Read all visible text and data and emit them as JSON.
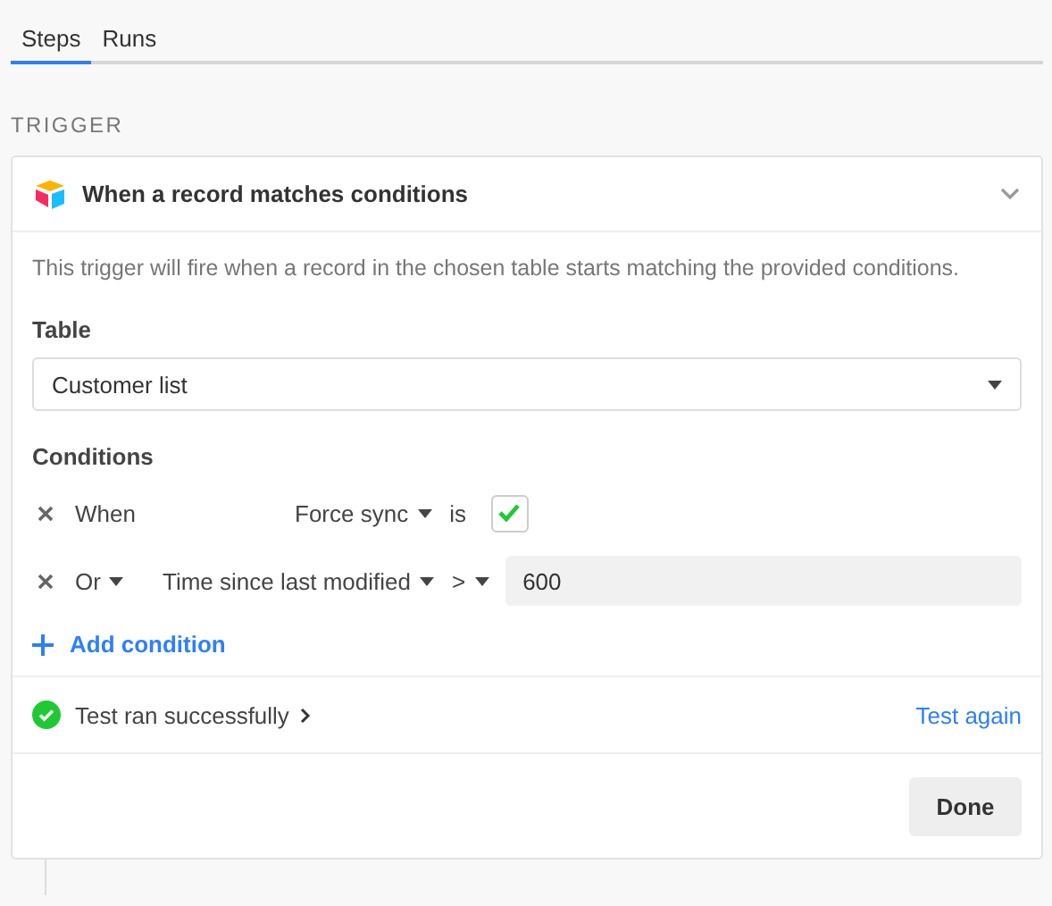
{
  "tabs": [
    {
      "label": "Steps",
      "selected": true
    },
    {
      "label": "Runs",
      "selected": false
    }
  ],
  "section_title": "TRIGGER",
  "trigger": {
    "title": "When a record matches conditions",
    "expanded": true,
    "description": "This trigger will fire when a record in the chosen table starts matching the provided conditions.",
    "table": {
      "label": "Table",
      "value": "Customer list"
    },
    "conditions_label": "Conditions",
    "conditions": [
      {
        "kind": "checkbox",
        "conjunction": "When",
        "conjunction_menu": false,
        "field": "Force sync",
        "operator": "is",
        "operator_menu": false,
        "checked": true
      },
      {
        "kind": "text",
        "conjunction": "Or",
        "conjunction_menu": true,
        "field": "Time since last modified",
        "operator": ">",
        "operator_menu": true,
        "value": "600"
      }
    ],
    "add_condition": "Add condition",
    "test": {
      "status": "Test ran successfully",
      "success": true,
      "action": "Test again"
    },
    "done": "Done"
  }
}
